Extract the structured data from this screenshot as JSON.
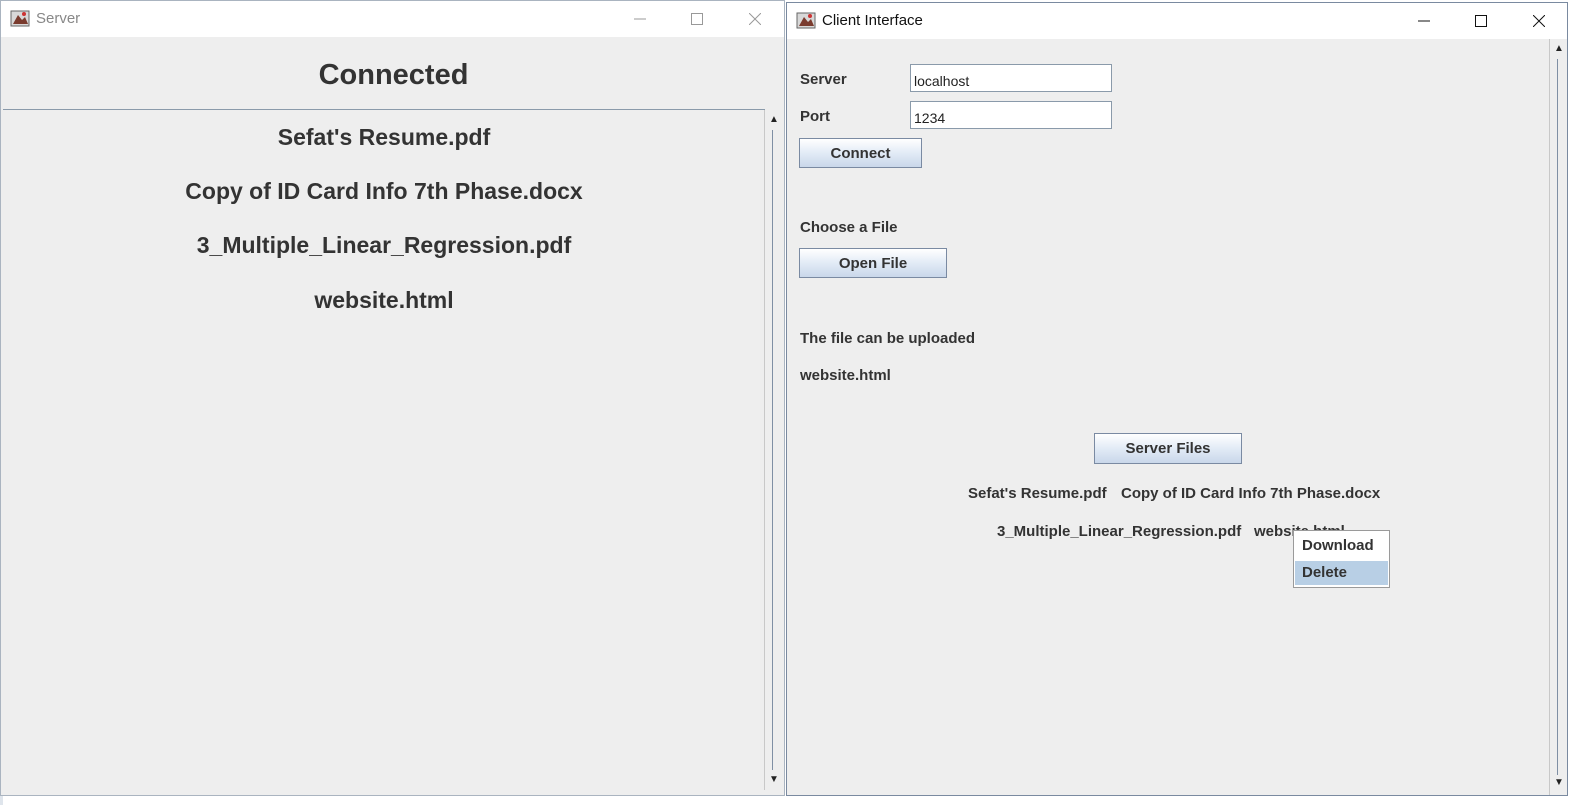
{
  "server_window": {
    "title": "Server",
    "status": "Connected",
    "files": [
      "Sefat's Resume.pdf",
      "Copy of ID Card Info 7th Phase.docx",
      "3_Multiple_Linear_Regression.pdf",
      "website.html"
    ],
    "controls": [
      "minimize-icon",
      "maximize-icon",
      "close-icon"
    ]
  },
  "client_window": {
    "title": "Client Interface",
    "server_label": "Server",
    "server_value": "localhost",
    "port_label": "Port",
    "port_value": "1234",
    "connect_button": "Connect",
    "choose_file_label": "Choose a File",
    "open_file_button": "Open File",
    "upload_status": "The file can be uploaded",
    "selected_file": "website.html",
    "server_files_button": "Server Files",
    "server_files": [
      "Sefat's Resume.pdf",
      "Copy of ID Card Info 7th Phase.docx",
      "3_Multiple_Linear_Regression.pdf",
      "website.html"
    ],
    "context_menu": {
      "items": [
        "Download",
        "Delete"
      ],
      "highlighted": "Delete"
    },
    "controls": [
      "minimize-icon",
      "maximize-icon",
      "close-icon"
    ]
  },
  "colors": {
    "window_bg": "#eeeeee",
    "menu_highlight": "#b8cfe5",
    "button_gradient_end": "#c9d7ea"
  }
}
